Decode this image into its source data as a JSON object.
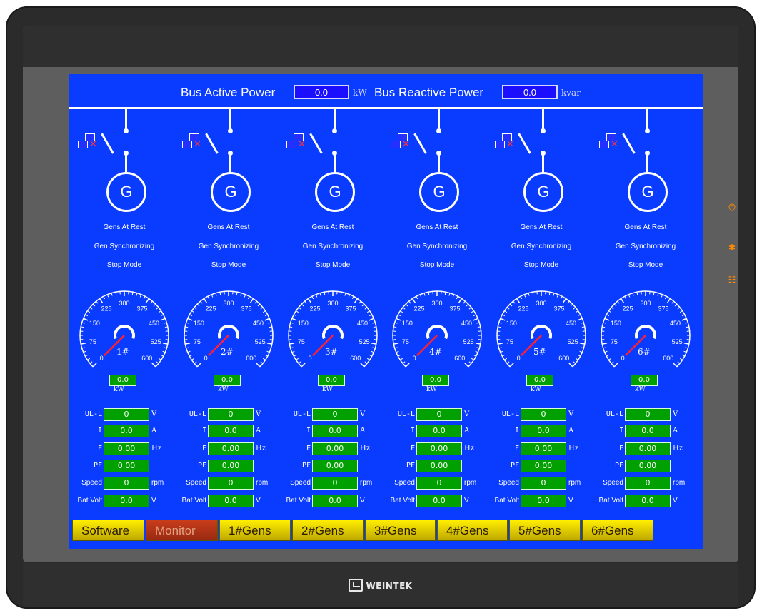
{
  "header": {
    "bus_active_label": "Bus Active Power",
    "bus_active_value": "0.0",
    "bus_active_unit": "kW",
    "bus_reactive_label": "Bus Reactive Power",
    "bus_reactive_value": "0.0",
    "bus_reactive_unit": "kvar"
  },
  "brand": "WEINTEK",
  "side_leds": [
    "power-led-icon",
    "sun-led-icon",
    "network-led-icon"
  ],
  "colors": {
    "screen_bg": "#0a3cff",
    "value_box": "#00a000",
    "nav_btn": "#ffee00",
    "nav_active": "#b8301a",
    "led": "#ff8a00"
  },
  "gens": [
    {
      "name": "1#",
      "status1": "Gens At Rest",
      "status2": "Gen Synchronizing",
      "status3": "Stop Mode",
      "kw": "0.0",
      "kw_unit": "kW",
      "ull": "0",
      "i": "0.0",
      "f": "0.00",
      "pf": "0.00",
      "speed": "0",
      "bat": "0.0"
    },
    {
      "name": "2#",
      "status1": "Gens At Rest",
      "status2": "Gen Synchronizing",
      "status3": "Stop Mode",
      "kw": "0.0",
      "kw_unit": "kW",
      "ull": "0",
      "i": "0.0",
      "f": "0.00",
      "pf": "0.00",
      "speed": "0",
      "bat": "0.0"
    },
    {
      "name": "3#",
      "status1": "Gens At Rest",
      "status2": "Gen Synchronizing",
      "status3": "Stop Mode",
      "kw": "0.0",
      "kw_unit": "kW",
      "ull": "0",
      "i": "0.0",
      "f": "0.00",
      "pf": "0.00",
      "speed": "0",
      "bat": "0.0"
    },
    {
      "name": "4#",
      "status1": "Gens At Rest",
      "status2": "Gen Synchronizing",
      "status3": "Stop Mode",
      "kw": "0.0",
      "kw_unit": "kW",
      "ull": "0",
      "i": "0.0",
      "f": "0.00",
      "pf": "0.00",
      "speed": "0",
      "bat": "0.0"
    },
    {
      "name": "5#",
      "status1": "Gens At Rest",
      "status2": "Gen Synchronizing",
      "status3": "Stop Mode",
      "kw": "0.0",
      "kw_unit": "kW",
      "ull": "0",
      "i": "0.0",
      "f": "0.00",
      "pf": "0.00",
      "speed": "0",
      "bat": "0.0"
    },
    {
      "name": "6#",
      "status1": "Gens At Rest",
      "status2": "Gen Synchronizing",
      "status3": "Stop Mode",
      "kw": "0.0",
      "kw_unit": "kW",
      "ull": "0",
      "i": "0.0",
      "f": "0.00",
      "pf": "0.00",
      "speed": "0",
      "bat": "0.0"
    }
  ],
  "gen_symbol": "G",
  "gauge_ticks": [
    "0",
    "75",
    "150",
    "225",
    "300",
    "375",
    "450",
    "525",
    "600"
  ],
  "param_labels": {
    "ull": "UL-L",
    "i": "I",
    "f": "F",
    "pf": "PF",
    "speed": "Speed",
    "bat": "Bat Volt"
  },
  "param_units": {
    "ull": "V",
    "i": "A",
    "f": "Hz",
    "pf": "",
    "speed": "rpm",
    "bat": "V"
  },
  "nav": [
    "Software",
    "Monitor",
    "1#Gens",
    "2#Gens",
    "3#Gens",
    "4#Gens",
    "5#Gens",
    "6#Gens"
  ],
  "nav_active": "Monitor"
}
